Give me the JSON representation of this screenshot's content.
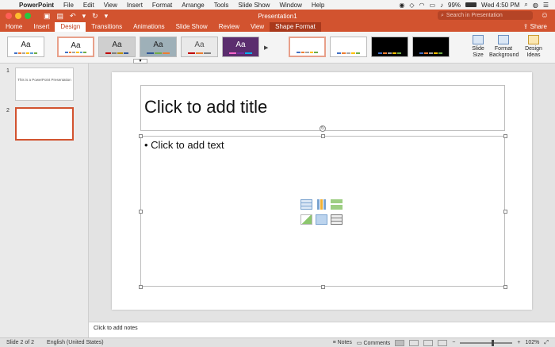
{
  "menubar": {
    "apple_icon": "apple-icon",
    "items": [
      "PowerPoint",
      "File",
      "Edit",
      "View",
      "Insert",
      "Format",
      "Arrange",
      "Tools",
      "Slide Show",
      "Window",
      "Help"
    ],
    "battery": "99%",
    "datetime": "Wed 4:50 PM"
  },
  "titlebar": {
    "doc_title": "Presentation1",
    "search_placeholder": "Search in Presentation"
  },
  "ribbon_tabs": [
    "Home",
    "Insert",
    "Design",
    "Transitions",
    "Animations",
    "Slide Show",
    "Review",
    "View",
    "Shape Format"
  ],
  "active_tab": "Design",
  "share_label": "Share",
  "themes": [
    {
      "label": "Aa",
      "bg": "#ffffff",
      "fg": "#222222"
    },
    {
      "label": "Aa",
      "bg": "#ffffff",
      "fg": "#222222"
    },
    {
      "label": "Aa",
      "bg": "#cfcfcf",
      "fg": "#222222"
    },
    {
      "label": "Aa",
      "bg": "#9eb0b8",
      "fg": "#222222"
    },
    {
      "label": "Aa",
      "bg": "#e9e9e9",
      "fg": "#555555"
    },
    {
      "label": "Aa",
      "bg": "#5b2d6e",
      "fg": "#ffffff"
    }
  ],
  "variants": [
    {
      "bg": "#ffffff"
    },
    {
      "bg": "#ffffff"
    },
    {
      "bg": "#000000"
    },
    {
      "bg": "#000000"
    }
  ],
  "ribbon_buttons": {
    "slide_size": "Slide Size",
    "format_background": "Format Background",
    "design_ideas": "Design Ideas"
  },
  "slides": [
    {
      "number": "1",
      "text": "This is a PowerPoint Presentation"
    },
    {
      "number": "2",
      "text": ""
    }
  ],
  "slide": {
    "title_placeholder": "Click to add title",
    "body_placeholder": "Click to add text"
  },
  "notes_placeholder": "Click to add notes",
  "status": {
    "slide_counter": "Slide 2 of 2",
    "language": "English (United States)",
    "notes_label": "Notes",
    "comments_label": "Comments",
    "zoom": "102%",
    "zoom_fraction": 0.6
  },
  "colors": {
    "accent": "#d2532f",
    "accent_dark": "#a9391c"
  }
}
